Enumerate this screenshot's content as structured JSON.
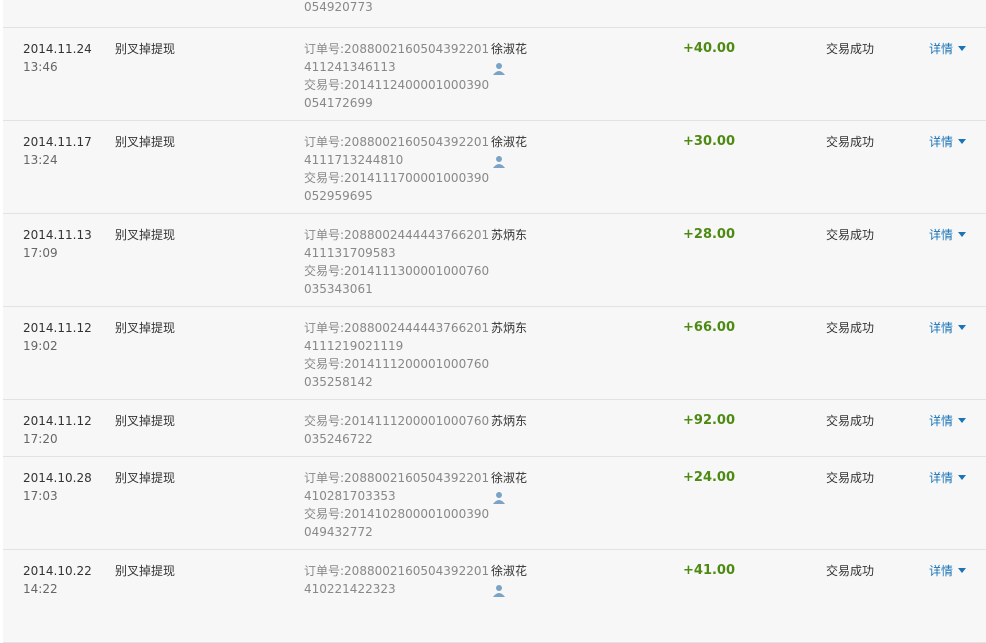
{
  "colors": {
    "amount": "#4d8a12",
    "link": "#1a74b8",
    "row_bg": "#f7f7f7",
    "border": "#e2e2e2"
  },
  "top_fragment": "054920773",
  "rows": [
    {
      "date": "2014.11.24",
      "time": "13:46",
      "name": "别叉掉提现",
      "numbers": [
        "订单号:208800216050439​2201",
        "411241346113",
        "交易号:20141124000010003​90",
        "054172699"
      ],
      "party": "徐淑花",
      "party_icon": "user-icon",
      "amount": "+40.00",
      "status": "交易成功",
      "detail": "详情"
    },
    {
      "date": "2014.11.17",
      "time": "13:24",
      "name": "别叉掉提现",
      "numbers": [
        "订单号:2088002160504392201",
        "4111713244810",
        "交易号:2014111700001000390",
        "052959695"
      ],
      "party": "徐淑花",
      "party_icon": "user-icon",
      "amount": "+30.00",
      "status": "交易成功",
      "detail": "详情"
    },
    {
      "date": "2014.11.13",
      "time": "17:09",
      "name": "别叉掉提现",
      "numbers": [
        "订单号:2088002444443766201",
        "411131709583",
        "交易号:2014111300001000760",
        "035343061"
      ],
      "party": "苏炳东",
      "party_icon": "",
      "amount": "+28.00",
      "status": "交易成功",
      "detail": "详情"
    },
    {
      "date": "2014.11.12",
      "time": "19:02",
      "name": "别叉掉提现",
      "numbers": [
        "订单号:2088002444443766201",
        "4111219021119",
        "交易号:2014111200001000760",
        "035258142"
      ],
      "party": "苏炳东",
      "party_icon": "",
      "amount": "+66.00",
      "status": "交易成功",
      "detail": "详情"
    },
    {
      "date": "2014.11.12",
      "time": "17:20",
      "name": "别叉掉提现",
      "numbers": [
        "交易号:2014111200001000760",
        "035246722"
      ],
      "party": "苏炳东",
      "party_icon": "",
      "amount": "+92.00",
      "status": "交易成功",
      "detail": "详情"
    },
    {
      "date": "2014.10.28",
      "time": "17:03",
      "name": "别叉掉提现",
      "numbers": [
        "订单号:2088002160504392201",
        "410281703353",
        "交易号:2014102800001000390",
        "049432772"
      ],
      "party": "徐淑花",
      "party_icon": "user-icon",
      "amount": "+24.00",
      "status": "交易成功",
      "detail": "详情"
    },
    {
      "date": "2014.10.22",
      "time": "14:22",
      "name": "别叉掉提现",
      "numbers": [
        "订单号:2088002160504392201",
        "410221422323"
      ],
      "party": "徐淑花",
      "party_icon": "user-icon",
      "amount": "+41.00",
      "status": "交易成功",
      "detail": "详情"
    }
  ]
}
